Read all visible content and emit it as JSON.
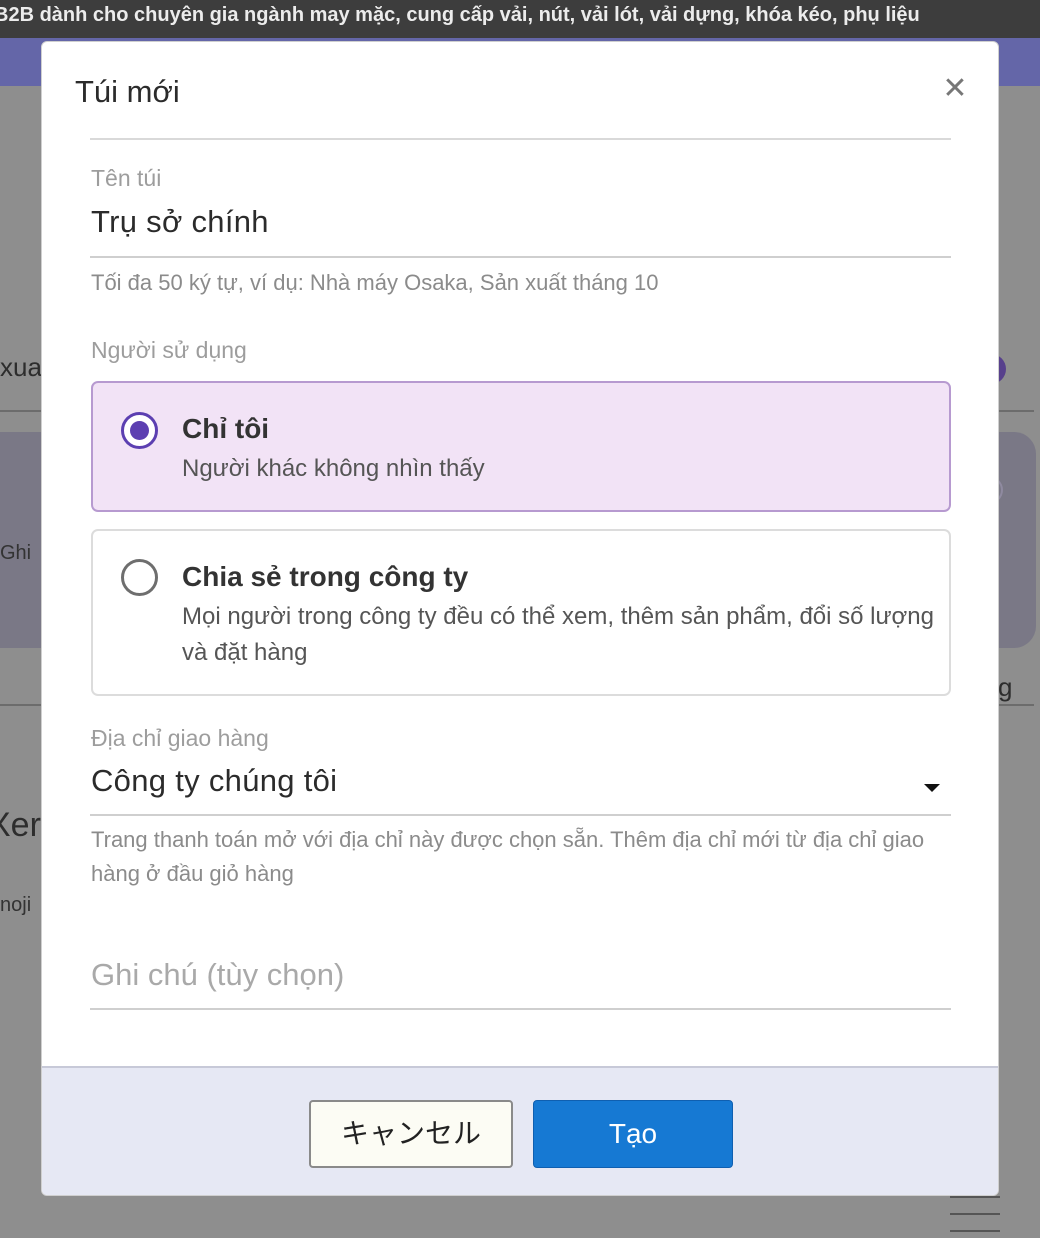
{
  "background": {
    "banner_text": "B2B dành cho chuyên gia ngành may mặc, cung cấp vải, nút, vải lót, vải dựng, khóa kéo, phụ liệu",
    "left_fragments": [
      "xua",
      "Ghi",
      "Xer",
      "noji"
    ],
    "right_fragments": [
      "g"
    ]
  },
  "modal": {
    "title": "Túi mới",
    "close_icon": "close-icon",
    "bag_name": {
      "label": "Tên túi",
      "value": "Trụ sở chính",
      "helper": "Tối đa 50 ký tự, ví dụ: Nhà máy Osaka, Sản xuất tháng 10"
    },
    "users": {
      "label": "Người sử dụng",
      "options": [
        {
          "title": "Chỉ tôi",
          "description": "Người khác không nhìn thấy",
          "selected": true
        },
        {
          "title": "Chia sẻ trong công ty",
          "description": "Mọi người trong công ty đều có thể xem, thêm sản phẩm, đổi số lượng và đặt hàng",
          "selected": false
        }
      ]
    },
    "shipping": {
      "label": "Địa chỉ giao hàng",
      "value": "Công ty chúng tôi",
      "helper": "Trang thanh toán mở với địa chỉ này được chọn sẵn. Thêm địa chỉ mới từ địa chỉ giao hàng ở đầu giỏ hàng"
    },
    "note": {
      "placeholder": "Ghi chú (tùy chọn)"
    },
    "footer": {
      "cancel_label": "キャンセル",
      "create_label": "Tạo"
    }
  },
  "colors": {
    "accent": "#5c3fb1",
    "primary_button": "#1679d3",
    "selected_card_bg": "#f2e3f6",
    "footer_bg": "#e6e8f4"
  }
}
